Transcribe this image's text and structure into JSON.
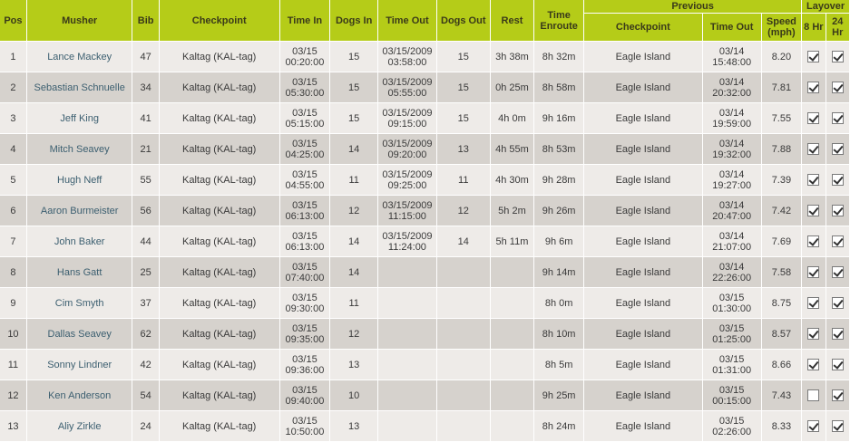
{
  "header": {
    "pos": "Pos",
    "musher": "Musher",
    "bib": "Bib",
    "checkpoint": "Checkpoint",
    "time_in": "Time In",
    "dogs_in": "Dogs In",
    "time_out": "Time Out",
    "dogs_out": "Dogs Out",
    "rest": "Rest",
    "time_enroute": "Time Enroute",
    "previous": "Previous",
    "prev_checkpoint": "Checkpoint",
    "prev_time_out": "Time Out",
    "speed": "Speed (mph)",
    "layover": "Layover",
    "hr8": "8 Hr",
    "hr24": "24 Hr"
  },
  "rows": [
    {
      "pos": "1",
      "musher": "Lance Mackey",
      "bib": "47",
      "checkpoint": "Kaltag (KAL-tag)",
      "time_in_date": "03/15",
      "time_in_time": "00:20:00",
      "dogs_in": "15",
      "time_out_date": "03/15/2009",
      "time_out_time": "03:58:00",
      "dogs_out": "15",
      "rest": "3h 38m",
      "enroute": "8h 32m",
      "prev_checkpoint": "Eagle Island",
      "prev_date": "03/14",
      "prev_time": "15:48:00",
      "speed": "8.20",
      "hr8": true,
      "hr24": true
    },
    {
      "pos": "2",
      "musher": "Sebastian Schnuelle",
      "bib": "34",
      "checkpoint": "Kaltag (KAL-tag)",
      "time_in_date": "03/15",
      "time_in_time": "05:30:00",
      "dogs_in": "15",
      "time_out_date": "03/15/2009",
      "time_out_time": "05:55:00",
      "dogs_out": "15",
      "rest": "0h 25m",
      "enroute": "8h 58m",
      "prev_checkpoint": "Eagle Island",
      "prev_date": "03/14",
      "prev_time": "20:32:00",
      "speed": "7.81",
      "hr8": true,
      "hr24": true
    },
    {
      "pos": "3",
      "musher": "Jeff King",
      "bib": "41",
      "checkpoint": "Kaltag (KAL-tag)",
      "time_in_date": "03/15",
      "time_in_time": "05:15:00",
      "dogs_in": "15",
      "time_out_date": "03/15/2009",
      "time_out_time": "09:15:00",
      "dogs_out": "15",
      "rest": "4h 0m",
      "enroute": "9h 16m",
      "prev_checkpoint": "Eagle Island",
      "prev_date": "03/14",
      "prev_time": "19:59:00",
      "speed": "7.55",
      "hr8": true,
      "hr24": true
    },
    {
      "pos": "4",
      "musher": "Mitch Seavey",
      "bib": "21",
      "checkpoint": "Kaltag (KAL-tag)",
      "time_in_date": "03/15",
      "time_in_time": "04:25:00",
      "dogs_in": "14",
      "time_out_date": "03/15/2009",
      "time_out_time": "09:20:00",
      "dogs_out": "13",
      "rest": "4h 55m",
      "enroute": "8h 53m",
      "prev_checkpoint": "Eagle Island",
      "prev_date": "03/14",
      "prev_time": "19:32:00",
      "speed": "7.88",
      "hr8": true,
      "hr24": true
    },
    {
      "pos": "5",
      "musher": "Hugh Neff",
      "bib": "55",
      "checkpoint": "Kaltag (KAL-tag)",
      "time_in_date": "03/15",
      "time_in_time": "04:55:00",
      "dogs_in": "11",
      "time_out_date": "03/15/2009",
      "time_out_time": "09:25:00",
      "dogs_out": "11",
      "rest": "4h 30m",
      "enroute": "9h 28m",
      "prev_checkpoint": "Eagle Island",
      "prev_date": "03/14",
      "prev_time": "19:27:00",
      "speed": "7.39",
      "hr8": true,
      "hr24": true
    },
    {
      "pos": "6",
      "musher": "Aaron Burmeister",
      "bib": "56",
      "checkpoint": "Kaltag (KAL-tag)",
      "time_in_date": "03/15",
      "time_in_time": "06:13:00",
      "dogs_in": "12",
      "time_out_date": "03/15/2009",
      "time_out_time": "11:15:00",
      "dogs_out": "12",
      "rest": "5h 2m",
      "enroute": "9h 26m",
      "prev_checkpoint": "Eagle Island",
      "prev_date": "03/14",
      "prev_time": "20:47:00",
      "speed": "7.42",
      "hr8": true,
      "hr24": true
    },
    {
      "pos": "7",
      "musher": "John Baker",
      "bib": "44",
      "checkpoint": "Kaltag (KAL-tag)",
      "time_in_date": "03/15",
      "time_in_time": "06:13:00",
      "dogs_in": "14",
      "time_out_date": "03/15/2009",
      "time_out_time": "11:24:00",
      "dogs_out": "14",
      "rest": "5h 11m",
      "enroute": "9h 6m",
      "prev_checkpoint": "Eagle Island",
      "prev_date": "03/14",
      "prev_time": "21:07:00",
      "speed": "7.69",
      "hr8": true,
      "hr24": true
    },
    {
      "pos": "8",
      "musher": "Hans Gatt",
      "bib": "25",
      "checkpoint": "Kaltag (KAL-tag)",
      "time_in_date": "03/15",
      "time_in_time": "07:40:00",
      "dogs_in": "14",
      "time_out_date": "",
      "time_out_time": "",
      "dogs_out": "",
      "rest": "",
      "enroute": "9h 14m",
      "prev_checkpoint": "Eagle Island",
      "prev_date": "03/14",
      "prev_time": "22:26:00",
      "speed": "7.58",
      "hr8": true,
      "hr24": true
    },
    {
      "pos": "9",
      "musher": "Cim Smyth",
      "bib": "37",
      "checkpoint": "Kaltag (KAL-tag)",
      "time_in_date": "03/15",
      "time_in_time": "09:30:00",
      "dogs_in": "11",
      "time_out_date": "",
      "time_out_time": "",
      "dogs_out": "",
      "rest": "",
      "enroute": "8h 0m",
      "prev_checkpoint": "Eagle Island",
      "prev_date": "03/15",
      "prev_time": "01:30:00",
      "speed": "8.75",
      "hr8": true,
      "hr24": true
    },
    {
      "pos": "10",
      "musher": "Dallas Seavey",
      "bib": "62",
      "checkpoint": "Kaltag (KAL-tag)",
      "time_in_date": "03/15",
      "time_in_time": "09:35:00",
      "dogs_in": "12",
      "time_out_date": "",
      "time_out_time": "",
      "dogs_out": "",
      "rest": "",
      "enroute": "8h 10m",
      "prev_checkpoint": "Eagle Island",
      "prev_date": "03/15",
      "prev_time": "01:25:00",
      "speed": "8.57",
      "hr8": true,
      "hr24": true
    },
    {
      "pos": "11",
      "musher": "Sonny Lindner",
      "bib": "42",
      "checkpoint": "Kaltag (KAL-tag)",
      "time_in_date": "03/15",
      "time_in_time": "09:36:00",
      "dogs_in": "13",
      "time_out_date": "",
      "time_out_time": "",
      "dogs_out": "",
      "rest": "",
      "enroute": "8h 5m",
      "prev_checkpoint": "Eagle Island",
      "prev_date": "03/15",
      "prev_time": "01:31:00",
      "speed": "8.66",
      "hr8": true,
      "hr24": true
    },
    {
      "pos": "12",
      "musher": "Ken Anderson",
      "bib": "54",
      "checkpoint": "Kaltag (KAL-tag)",
      "time_in_date": "03/15",
      "time_in_time": "09:40:00",
      "dogs_in": "10",
      "time_out_date": "",
      "time_out_time": "",
      "dogs_out": "",
      "rest": "",
      "enroute": "9h 25m",
      "prev_checkpoint": "Eagle Island",
      "prev_date": "03/15",
      "prev_time": "00:15:00",
      "speed": "7.43",
      "hr8": false,
      "hr24": true
    },
    {
      "pos": "13",
      "musher": "Aliy Zirkle",
      "bib": "24",
      "checkpoint": "Kaltag (KAL-tag)",
      "time_in_date": "03/15",
      "time_in_time": "10:50:00",
      "dogs_in": "13",
      "time_out_date": "",
      "time_out_time": "",
      "dogs_out": "",
      "rest": "",
      "enroute": "8h 24m",
      "prev_checkpoint": "Eagle Island",
      "prev_date": "03/15",
      "prev_time": "02:26:00",
      "speed": "8.33",
      "hr8": true,
      "hr24": true
    }
  ],
  "colors": {
    "header_bg": "#b5cc18",
    "row_light": "#eeebe8",
    "row_dark": "#d6d2cd",
    "musher_text": "#3c5f70"
  }
}
